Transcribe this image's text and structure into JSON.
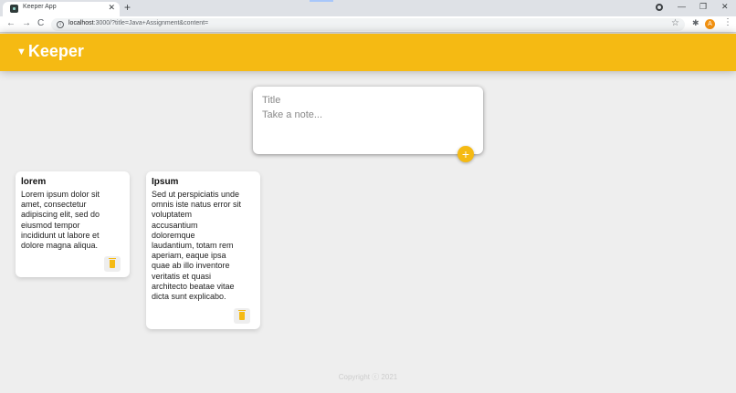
{
  "browser": {
    "tab_title": "Keeper App",
    "tab_close": "✕",
    "new_tab": "+",
    "url_host": "localhost",
    "url_rest": ":3000/?title=Java+Assignment&content=",
    "profile_initial": "A",
    "back": "←",
    "forward": "→",
    "reload": "C",
    "star": "☆",
    "extensions": "✱",
    "menu": "⋮",
    "minimize": "—",
    "maximize": "❐",
    "close": "✕"
  },
  "app": {
    "logo": "Keeper",
    "logo_mark": "▼",
    "create": {
      "title_placeholder": "Title",
      "content_placeholder": "Take a note...",
      "add_label": "+"
    },
    "notes": [
      {
        "title": "lorem",
        "content": "Lorem ipsum dolor sit\namet, consectetur\nadipiscing elit, sed do\neiusmod tempor\nincididunt ut labore et\ndolore magna aliqua."
      },
      {
        "title": "Ipsum",
        "content": "Sed ut perspiciatis unde\nomnis iste natus error sit\nvoluptatem\naccusantium\ndoloremque\nlaudantium, totam rem\naperiam, eaque ipsa\nquae ab illo inventore\nveritatis et quasi\narchitecto beatae vitae\ndicta sunt explicabo."
      }
    ],
    "footer": "Copyright ⓒ 2021"
  },
  "colors": {
    "accent": "#f5ba13",
    "background": "#eeeeee"
  }
}
